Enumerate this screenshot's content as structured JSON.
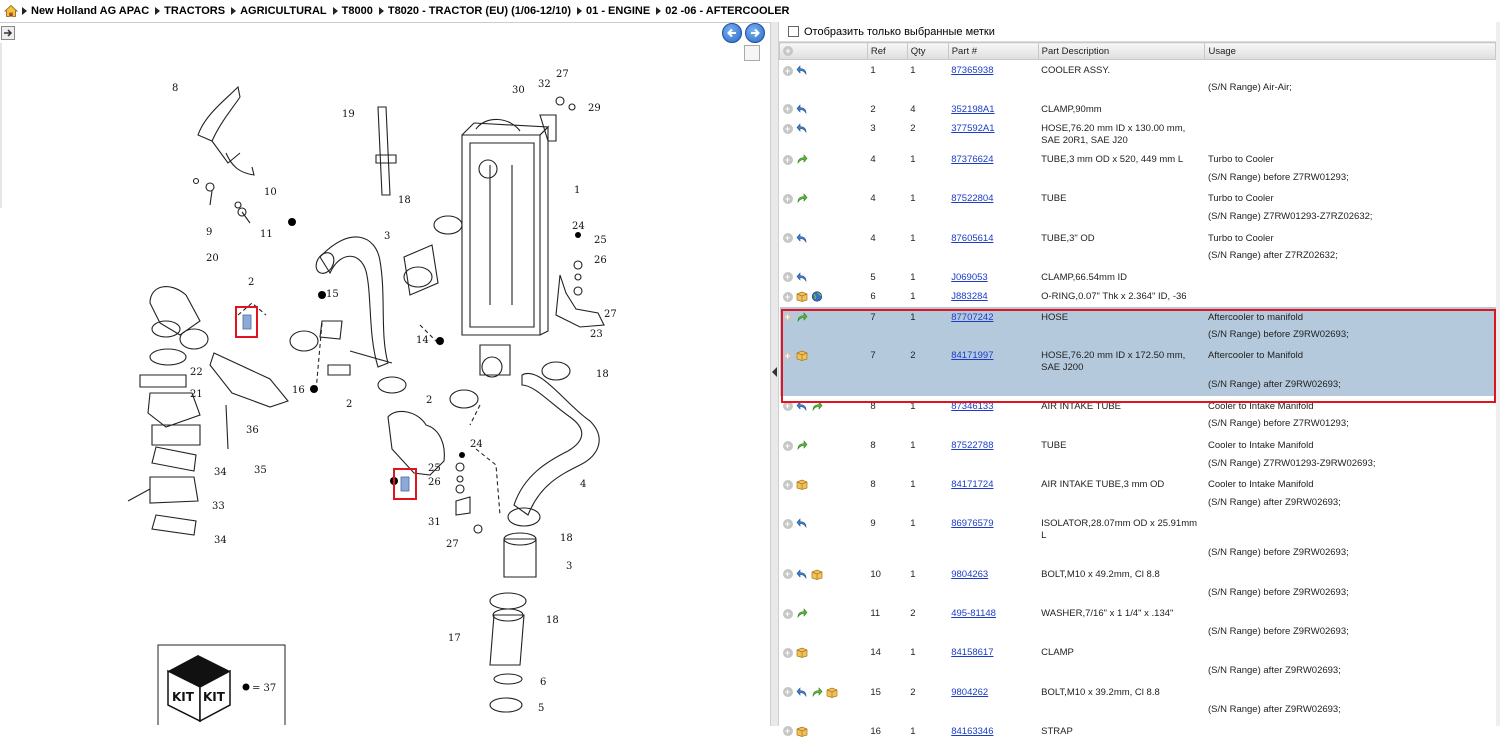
{
  "breadcrumb": {
    "items": [
      "New Holland AG APAC",
      "TRACTORS",
      "AGRICULTURAL",
      "T8000",
      "T8020 - TRACTOR (EU) (1/06-12/10)",
      "01 - ENGINE",
      "02 -06 - AFTERCOOLER"
    ]
  },
  "filter": {
    "label": "Отобразить только выбранные метки"
  },
  "table": {
    "headers": {
      "ref": "Ref",
      "qty": "Qty",
      "part": "Part #",
      "desc": "Part Description",
      "usage": "Usage"
    },
    "rows": [
      {
        "icons": [
          "back"
        ],
        "ref": "1",
        "qty": "1",
        "part": "87365938",
        "desc": "COOLER ASSY.",
        "usage": "",
        "cont": "(S/N Range) Air-Air;"
      },
      {
        "icons": [
          "back"
        ],
        "ref": "2",
        "qty": "4",
        "part": "352198A1",
        "desc": "CLAMP,90mm",
        "usage": ""
      },
      {
        "icons": [
          "back"
        ],
        "ref": "3",
        "qty": "2",
        "part": "377592A1",
        "desc": "HOSE,76.20 mm ID x 130.00 mm, SAE 20R1, SAE J20",
        "usage": ""
      },
      {
        "icons": [
          "fwd"
        ],
        "ref": "4",
        "qty": "1",
        "part": "87376624",
        "desc": "TUBE,3 mm OD x 520, 449 mm L",
        "usage": "Turbo to Cooler",
        "cont": "(S/N Range) before Z7RW01293;"
      },
      {
        "icons": [
          "fwd"
        ],
        "ref": "4",
        "qty": "1",
        "part": "87522804",
        "desc": "TUBE",
        "usage": "Turbo to Cooler",
        "cont": "(S/N Range) Z7RW01293-Z7RZ02632;"
      },
      {
        "icons": [
          "back"
        ],
        "ref": "4",
        "qty": "1",
        "part": "87605614",
        "desc": "TUBE,3\" OD",
        "usage": "Turbo to Cooler",
        "cont": "(S/N Range) after Z7RZ02632;"
      },
      {
        "icons": [
          "back"
        ],
        "ref": "5",
        "qty": "1",
        "part": "J069053",
        "desc": "CLAMP,66.54mm ID",
        "usage": ""
      },
      {
        "icons": [
          "box",
          "globe"
        ],
        "ref": "6",
        "qty": "1",
        "part": "J883284",
        "desc": "O-RING,0.07\" Thk x 2.364\" ID, -36",
        "usage": ""
      },
      {
        "icons": [
          "fwd"
        ],
        "ref": "7",
        "qty": "1",
        "part": "87707242",
        "desc": "HOSE",
        "usage": "Aftercooler to manifold",
        "cont": "(S/N Range) before Z9RW02693;",
        "sel": true
      },
      {
        "icons": [
          "box"
        ],
        "ref": "7",
        "qty": "2",
        "part": "84171997",
        "desc": "HOSE,76.20 mm ID x 172.50 mm, SAE J200",
        "usage": "Aftercooler to Manifold",
        "cont": "(S/N Range) after Z9RW02693;",
        "sel": true
      },
      {
        "icons": [
          "back",
          "fwd"
        ],
        "ref": "8",
        "qty": "1",
        "part": "87346133",
        "desc": "AIR INTAKE TUBE",
        "usage": "Cooler to Intake Manifold",
        "cont": "(S/N Range) before Z7RW01293;"
      },
      {
        "icons": [
          "fwd"
        ],
        "ref": "8",
        "qty": "1",
        "part": "87522788",
        "desc": "TUBE",
        "usage": "Cooler to Intake Manifold",
        "cont": "(S/N Range) Z7RW01293-Z9RW02693;"
      },
      {
        "icons": [
          "box"
        ],
        "ref": "8",
        "qty": "1",
        "part": "84171724",
        "desc": "AIR INTAKE TUBE,3 mm OD",
        "usage": "Cooler to Intake Manifold",
        "cont": "(S/N Range) after Z9RW02693;"
      },
      {
        "icons": [
          "back"
        ],
        "ref": "9",
        "qty": "1",
        "part": "86976579",
        "desc": "ISOLATOR,28.07mm OD x 25.91mm L",
        "usage": "",
        "cont": "(S/N Range) before Z9RW02693;"
      },
      {
        "icons": [
          "back",
          "box"
        ],
        "ref": "10",
        "qty": "1",
        "part": "9804263",
        "desc": "BOLT,M10 x 49.2mm, Cl 8.8",
        "usage": "",
        "cont": "(S/N Range) before Z9RW02693;"
      },
      {
        "icons": [
          "fwd"
        ],
        "ref": "11",
        "qty": "2",
        "part": "495-81148",
        "desc": "WASHER,7/16\" x 1 1/4\" x .134\"",
        "usage": "",
        "cont": "(S/N Range) before Z9RW02693;"
      },
      {
        "icons": [
          "box"
        ],
        "ref": "14",
        "qty": "1",
        "part": "84158617",
        "desc": "CLAMP",
        "usage": "",
        "cont": "(S/N Range) after Z9RW02693;"
      },
      {
        "icons": [
          "back",
          "fwd",
          "box"
        ],
        "ref": "15",
        "qty": "2",
        "part": "9804262",
        "desc": "BOLT,M10 x 39.2mm, Cl 8.8",
        "usage": "",
        "cont": "(S/N Range) after Z9RW02693;"
      },
      {
        "icons": [
          "box"
        ],
        "ref": "16",
        "qty": "1",
        "part": "84163346",
        "desc": "STRAP",
        "usage": ""
      }
    ]
  },
  "diagram": {
    "callouts": [
      "8",
      "32",
      "30",
      "27",
      "29",
      "19",
      "10",
      "9",
      "11",
      "18",
      "1",
      "3",
      "24",
      "25",
      "26",
      "20",
      "2",
      "15",
      "14",
      "23",
      "27",
      "16",
      "22",
      "21",
      "36",
      "35",
      "34",
      "33",
      "34",
      "2",
      "2",
      "24",
      "25",
      "26",
      "31",
      "27",
      "18",
      "4",
      "18",
      "3",
      "18",
      "17",
      "6",
      "5"
    ],
    "kit_label": "KIT",
    "kit_legend": "= 37"
  }
}
